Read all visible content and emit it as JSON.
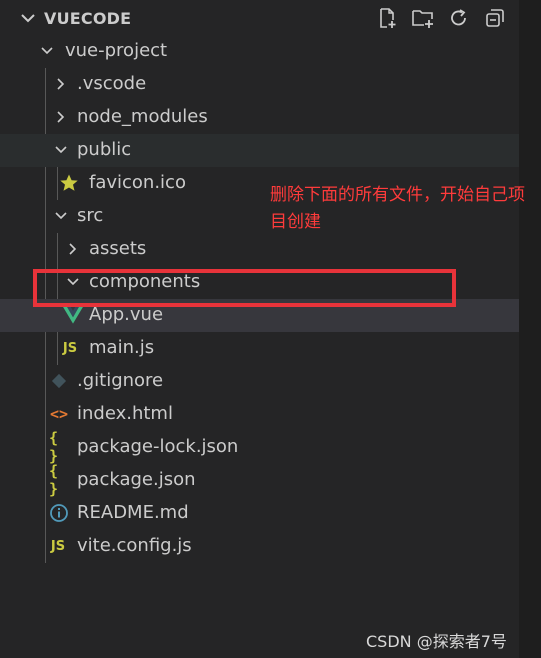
{
  "explorer": {
    "title": "VUECODE",
    "actions": [
      "new-file-icon",
      "new-folder-icon",
      "refresh-icon",
      "collapse-all-icon"
    ]
  },
  "tree": {
    "project": "vue-project",
    "vscode": ".vscode",
    "node_modules": "node_modules",
    "public": "public",
    "favicon": "favicon.ico",
    "src": "src",
    "assets": "assets",
    "components": "components",
    "app_vue": "App.vue",
    "main_js": "main.js",
    "gitignore": ".gitignore",
    "index_html": "index.html",
    "package_lock": "package-lock.json",
    "package_json": "package.json",
    "readme": "README.md",
    "vite_config": "vite.config.js"
  },
  "file_icons": {
    "js": "JS",
    "json": "{ }",
    "html": "<>"
  },
  "annotation": "删除下面的所有文件，开始自己项目创建",
  "watermark": "CSDN @探索者7号",
  "colors": {
    "sidebar_bg": "#252526",
    "selected_row": "#37373d",
    "annotation_red": "#ff3b3b",
    "box_red": "#e8333a",
    "vue_green": "#41b883",
    "js_yellow": "#cbcb41"
  }
}
